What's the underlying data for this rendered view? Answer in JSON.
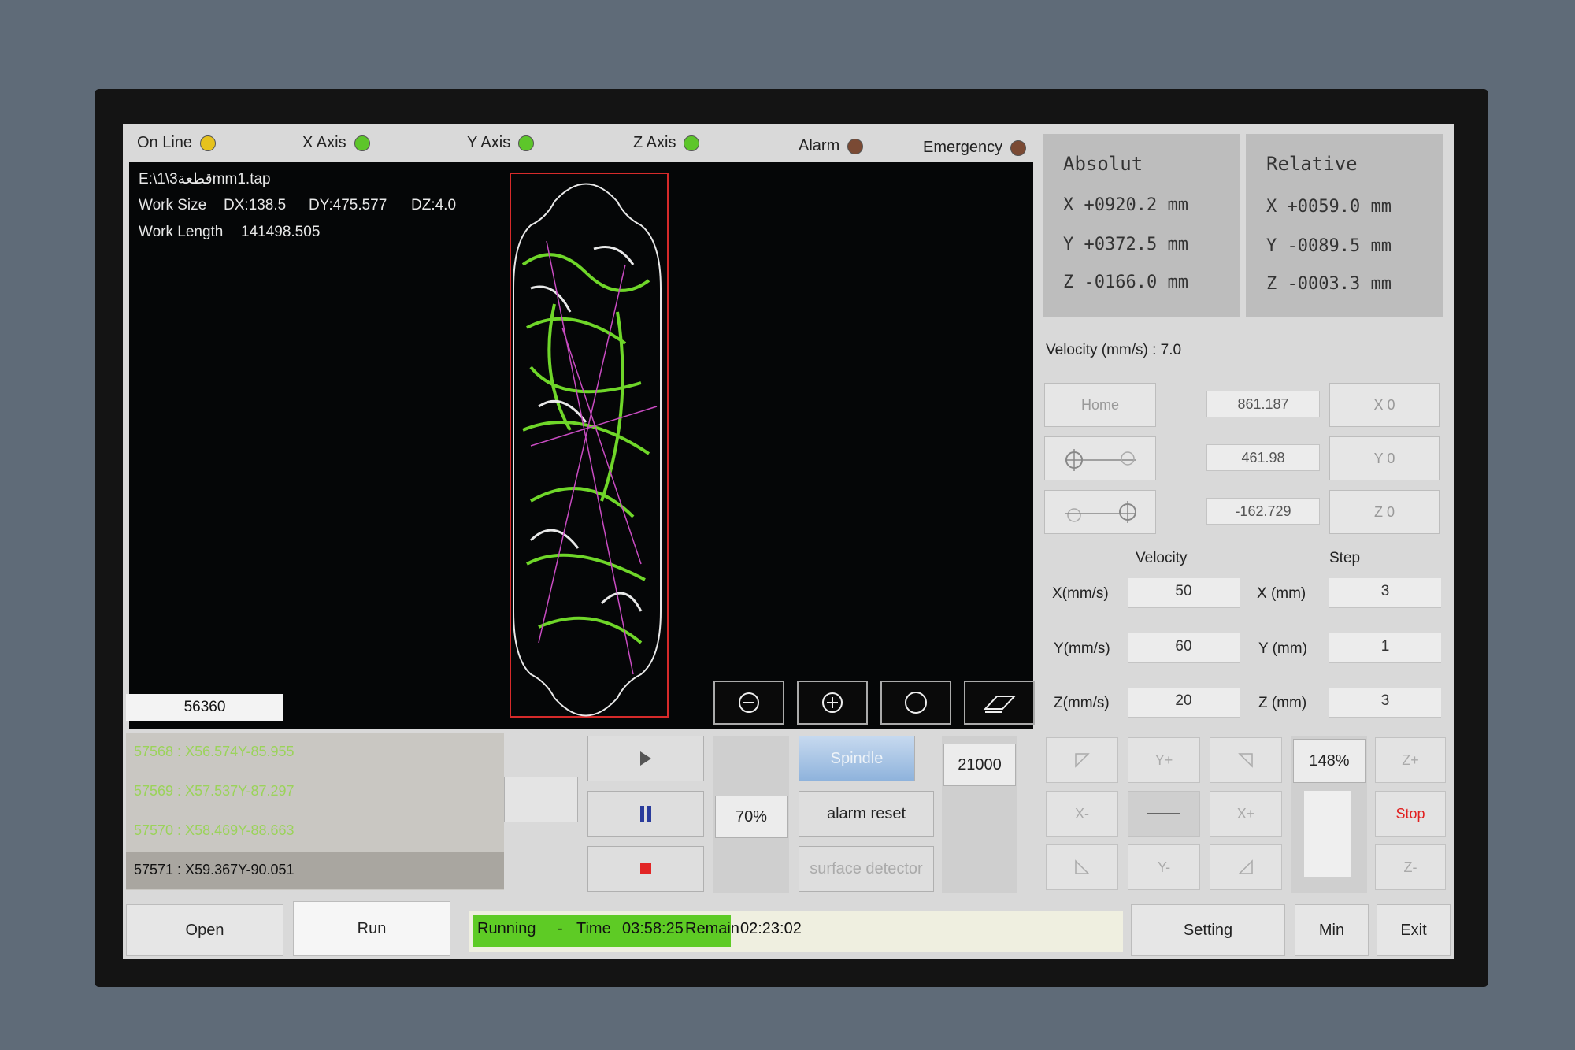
{
  "status_bar": {
    "online": {
      "label": "On Line",
      "color": "#e6c21c"
    },
    "x_axis": {
      "label": "X Axis",
      "color": "#5dc62a"
    },
    "y_axis": {
      "label": "Y Axis",
      "color": "#5dc62a"
    },
    "z_axis": {
      "label": "Z Axis",
      "color": "#5dc62a"
    },
    "alarm": {
      "label": "Alarm",
      "color": "#7a4a34"
    },
    "emergency": {
      "label": "Emergency",
      "color": "#7a4a34"
    }
  },
  "preview": {
    "file": "E:\\1\\3قطعةmm1.tap",
    "work_size_label": "Work Size",
    "dx": "DX:138.5",
    "dy": "DY:475.577",
    "dz": "DZ:4.0",
    "work_length_label": "Work Length",
    "work_length": "141498.505",
    "line_number": "56360",
    "zoom_buttons": [
      "zoom-out-icon",
      "zoom-in-icon",
      "circle-icon",
      "eraser-icon"
    ]
  },
  "absolute": {
    "title": "Absolut",
    "x": "X +0920.2 mm",
    "y": "Y +0372.5 mm",
    "z": "Z -0166.0 mm"
  },
  "relative": {
    "title": "Relative",
    "x": "X +0059.0 mm",
    "y": "Y -0089.5 mm",
    "z": "Z -0003.3 mm"
  },
  "velocity_readout": "Velocity (mm/s) : 7.0",
  "home": {
    "home_label": "Home",
    "values": [
      "861.187",
      "461.98",
      "-162.729"
    ],
    "zero_labels": [
      "X 0",
      "Y 0",
      "Z 0"
    ]
  },
  "motion": {
    "velocity_header": "Velocity",
    "step_header": "Step",
    "rows": [
      {
        "vel_label": "X(mm/s)",
        "vel": "50",
        "step_label": "X (mm)",
        "step": "3"
      },
      {
        "vel_label": "Y(mm/s)",
        "vel": "60",
        "step_label": "Y (mm)",
        "step": "1"
      },
      {
        "vel_label": "Z(mm/s)",
        "vel": "20",
        "step_label": "Z (mm)",
        "step": "3"
      }
    ]
  },
  "gcode": [
    "57568 : X56.574Y-85.955",
    "57569 : X57.537Y-87.297",
    "57570 : X58.469Y-88.663",
    "57571 : X59.367Y-90.051"
  ],
  "controls": {
    "feed_override": "70%",
    "spindle_label": "Spindle",
    "spindle_speed": "21000",
    "alarm_reset": "alarm reset",
    "surface_detector": "surface detector",
    "jog_percent": "148%"
  },
  "jog": {
    "y_plus": "Y+",
    "x_minus": "X-",
    "x_plus": "X+",
    "y_minus": "Y-",
    "z_plus": "Z+",
    "z_minus": "Z-",
    "stop": "Stop"
  },
  "bottom": {
    "open": "Open",
    "run": "Run",
    "running": "Running",
    "dash": "-",
    "time_label": "Time",
    "time": "03:58:25",
    "remain_label": "Remain",
    "remain": "02:23:02",
    "setting": "Setting",
    "min": "Min",
    "exit": "Exit"
  }
}
